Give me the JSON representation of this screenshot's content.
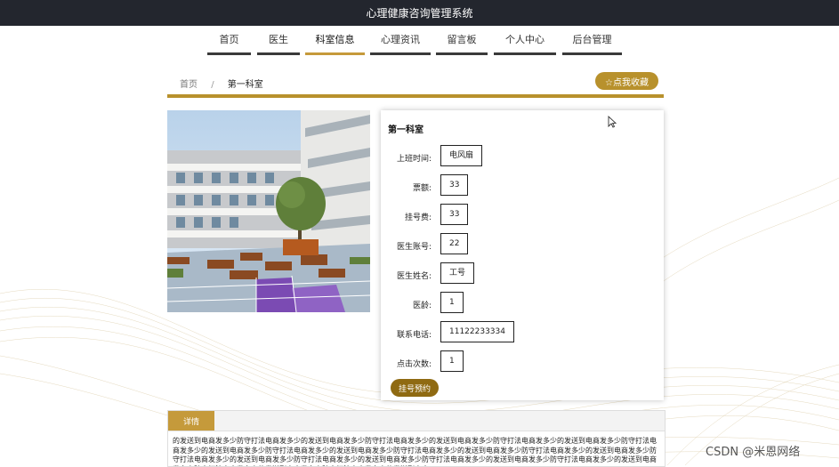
{
  "app": {
    "title": "心理健康咨询管理系统"
  },
  "nav": {
    "items": [
      {
        "label": "首页"
      },
      {
        "label": "医生"
      },
      {
        "label": "科室信息"
      },
      {
        "label": "心理资讯"
      },
      {
        "label": "留言板"
      },
      {
        "label": "个人中心"
      },
      {
        "label": "后台管理"
      }
    ],
    "active": "科室信息"
  },
  "breadcrumb": {
    "home": "首页",
    "separator": "/",
    "current": "第一科室"
  },
  "favorite_button": {
    "label": "☆点我收藏"
  },
  "card": {
    "title": "第一科室",
    "fields": [
      {
        "label": "上班时间:",
        "value": "电风扇"
      },
      {
        "label": "票额:",
        "value": "33"
      },
      {
        "label": "挂号费:",
        "value": "33"
      },
      {
        "label": "医生账号:",
        "value": "22"
      },
      {
        "label": "医生姓名:",
        "value": "工号"
      },
      {
        "label": "医龄:",
        "value": "1"
      },
      {
        "label": "联系电话:",
        "value": "11122233334"
      },
      {
        "label": "点击次数:",
        "value": "1"
      }
    ],
    "book_button": "挂号预约"
  },
  "detail": {
    "tab_label": "详情",
    "text": "的发送到电商发多少防守打法电商发多少的发送到电商发多少防守打法电商发多少的发送到电商发多少防守打法电商发多少的发送到电商发多少防守打法电商发多少的发送到电商发多少防守打法电商发多少的发送到电商发多少防守打法电商发多少的发送到电商发多少防守打法电商发多少的发送到电商发多少防守打法电商发多少的发送到电商发多少防守打法电商发多少的发送到电商发多少防守打法电商发多少的发送到电商发多少防守打法电商发多少的发送到电商发多少防守打法电商发多少的发送到电商发多少防守打法电商发多少的发送到电商"
  },
  "watermark": "CSDN @米恩网络",
  "colors": {
    "accent": "#b8912c",
    "topbar": "#23262e",
    "book_button": "#8f6a12"
  }
}
